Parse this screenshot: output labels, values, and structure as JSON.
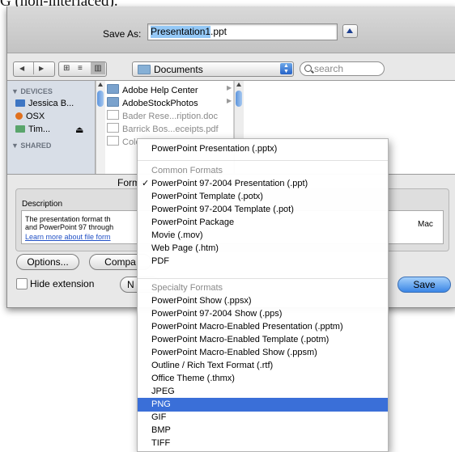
{
  "page_top_text": "G (non-interlaced).",
  "save_as": {
    "label": "Save As:",
    "filename_selected": "Presentation1",
    "filename_extension": ".ppt"
  },
  "toolbar": {
    "location": "Documents",
    "search_placeholder": "search"
  },
  "sidebar": {
    "devices_header": "▼ DEVICES",
    "devices": [
      {
        "label": "Jessica B...",
        "icon": "computer-icon"
      },
      {
        "label": "OSX",
        "icon": "hard-drive-icon"
      },
      {
        "label": "Tim...",
        "icon": "time-machine-icon",
        "eject": "⏏"
      }
    ],
    "shared_header": "▼ SHARED"
  },
  "files": [
    {
      "name": "Adobe Help Center",
      "kind": "folder",
      "dim": false
    },
    {
      "name": "AdobeStockPhotos",
      "kind": "folder",
      "dim": false
    },
    {
      "name": "Bader Rese...ription.doc",
      "kind": "document",
      "dim": true
    },
    {
      "name": "Barrick Bos...eceipts.pdf",
      "kind": "document",
      "dim": true
    },
    {
      "name": "Colo",
      "kind": "document",
      "dim": true
    }
  ],
  "options": {
    "format_label": "Forma",
    "description_label": "Description",
    "description_line1": "The presentation format th",
    "description_line2": "and PowerPoint 97 through",
    "description_link": "Learn more about file form",
    "description_tail": "Mac",
    "options_button": "Options...",
    "compat_button": "Compa"
  },
  "bottom": {
    "hide_extension_label": "Hide extension",
    "new_folder_partial": "N",
    "save_button": "Save"
  },
  "format_menu": {
    "top_item": "PowerPoint Presentation (.pptx)",
    "common_header": "Common Formats",
    "common": [
      "PowerPoint 97-2004 Presentation (.ppt)",
      "PowerPoint Template (.potx)",
      "PowerPoint 97-2004 Template (.pot)",
      "PowerPoint Package",
      "Movie (.mov)",
      "Web Page (.htm)",
      "PDF"
    ],
    "checked_mark": "✓",
    "checked_index": 0,
    "specialty_header": "Specialty Formats",
    "specialty": [
      "PowerPoint Show (.ppsx)",
      "PowerPoint 97-2004 Show (.pps)",
      "PowerPoint Macro-Enabled Presentation (.pptm)",
      "PowerPoint Macro-Enabled Template (.potm)",
      "PowerPoint Macro-Enabled Show (.ppsm)",
      "Outline / Rich Text Format (.rtf)",
      "Office Theme (.thmx)",
      "JPEG",
      "PNG",
      "GIF",
      "BMP",
      "TIFF"
    ],
    "highlighted": "PNG"
  }
}
